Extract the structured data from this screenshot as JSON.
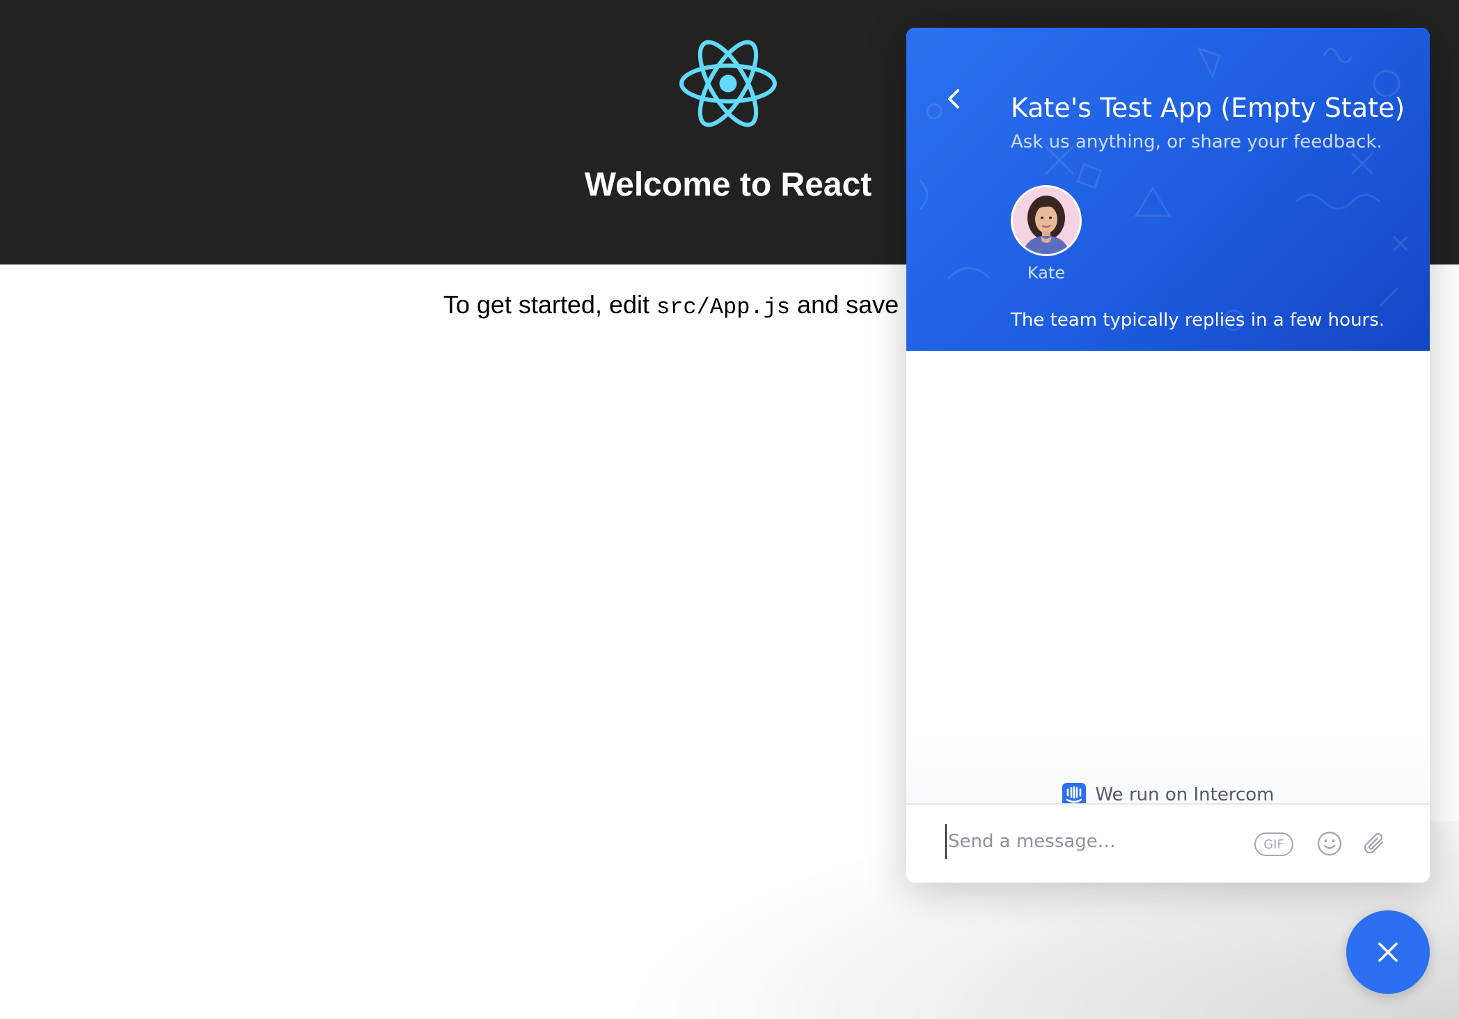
{
  "app": {
    "title": "Welcome to React",
    "intro_prefix": "To get started, edit ",
    "intro_code": "src/App.js",
    "intro_suffix": " and save",
    "header_color": "#222222",
    "logo_color": "#61dafb"
  },
  "messenger": {
    "title": "Kate's Test App (Empty State)",
    "subtitle": "Ask us anything, or share your feedback.",
    "teammate_name": "Kate",
    "reply_time": "The team typically replies in a few hours.",
    "powered_by": "We run on Intercom",
    "composer_placeholder": "Send a message…",
    "gif_label": "GIF",
    "accent_color": "#2c6ff0",
    "icons": {
      "back": "chevron-left-icon",
      "intercom": "intercom-logo-icon",
      "emoji": "smiley-icon",
      "attach": "paperclip-icon",
      "close": "close-icon"
    }
  }
}
